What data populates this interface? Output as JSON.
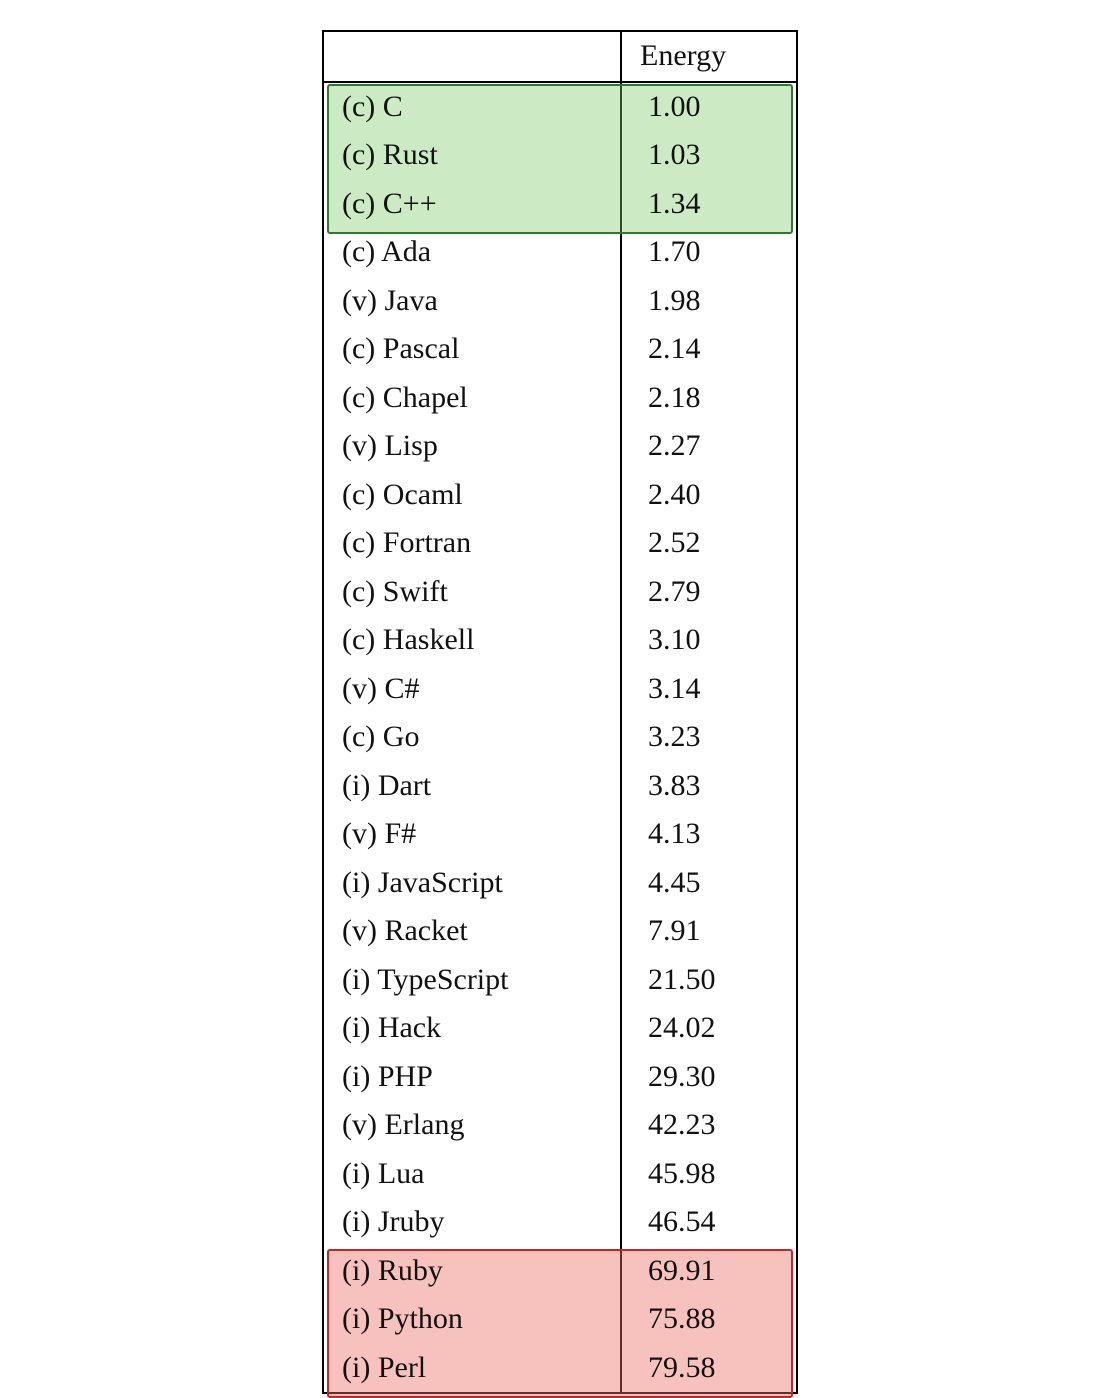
{
  "chart_data": {
    "type": "table",
    "title": "",
    "columns": [
      "",
      "Energy"
    ],
    "highlight_top_n": 3,
    "highlight_bottom_n": 3,
    "colors": {
      "top": "#b7e4a8",
      "bottom": "#f2a39c"
    },
    "rows": [
      {
        "lang": "(c) C",
        "energy": "1.00"
      },
      {
        "lang": "(c) Rust",
        "energy": "1.03"
      },
      {
        "lang": "(c) C++",
        "energy": "1.34"
      },
      {
        "lang": "(c) Ada",
        "energy": "1.70"
      },
      {
        "lang": "(v) Java",
        "energy": "1.98"
      },
      {
        "lang": "(c) Pascal",
        "energy": "2.14"
      },
      {
        "lang": "(c) Chapel",
        "energy": "2.18"
      },
      {
        "lang": "(v) Lisp",
        "energy": "2.27"
      },
      {
        "lang": "(c) Ocaml",
        "energy": "2.40"
      },
      {
        "lang": "(c) Fortran",
        "energy": "2.52"
      },
      {
        "lang": "(c) Swift",
        "energy": "2.79"
      },
      {
        "lang": "(c) Haskell",
        "energy": "3.10"
      },
      {
        "lang": "(v) C#",
        "energy": "3.14"
      },
      {
        "lang": "(c) Go",
        "energy": "3.23"
      },
      {
        "lang": "(i) Dart",
        "energy": "3.83"
      },
      {
        "lang": "(v) F#",
        "energy": "4.13"
      },
      {
        "lang": "(i) JavaScript",
        "energy": "4.45"
      },
      {
        "lang": "(v) Racket",
        "energy": "7.91"
      },
      {
        "lang": "(i) TypeScript",
        "energy": "21.50"
      },
      {
        "lang": "(i) Hack",
        "energy": "24.02"
      },
      {
        "lang": "(i) PHP",
        "energy": "29.30"
      },
      {
        "lang": "(v) Erlang",
        "energy": "42.23"
      },
      {
        "lang": "(i) Lua",
        "energy": "45.98"
      },
      {
        "lang": "(i) Jruby",
        "energy": "46.54"
      },
      {
        "lang": "(i) Ruby",
        "energy": "69.91"
      },
      {
        "lang": "(i) Python",
        "energy": "75.88"
      },
      {
        "lang": "(i) Perl",
        "energy": "79.58"
      }
    ]
  },
  "header": {
    "col0": "",
    "col1": "Energy"
  }
}
